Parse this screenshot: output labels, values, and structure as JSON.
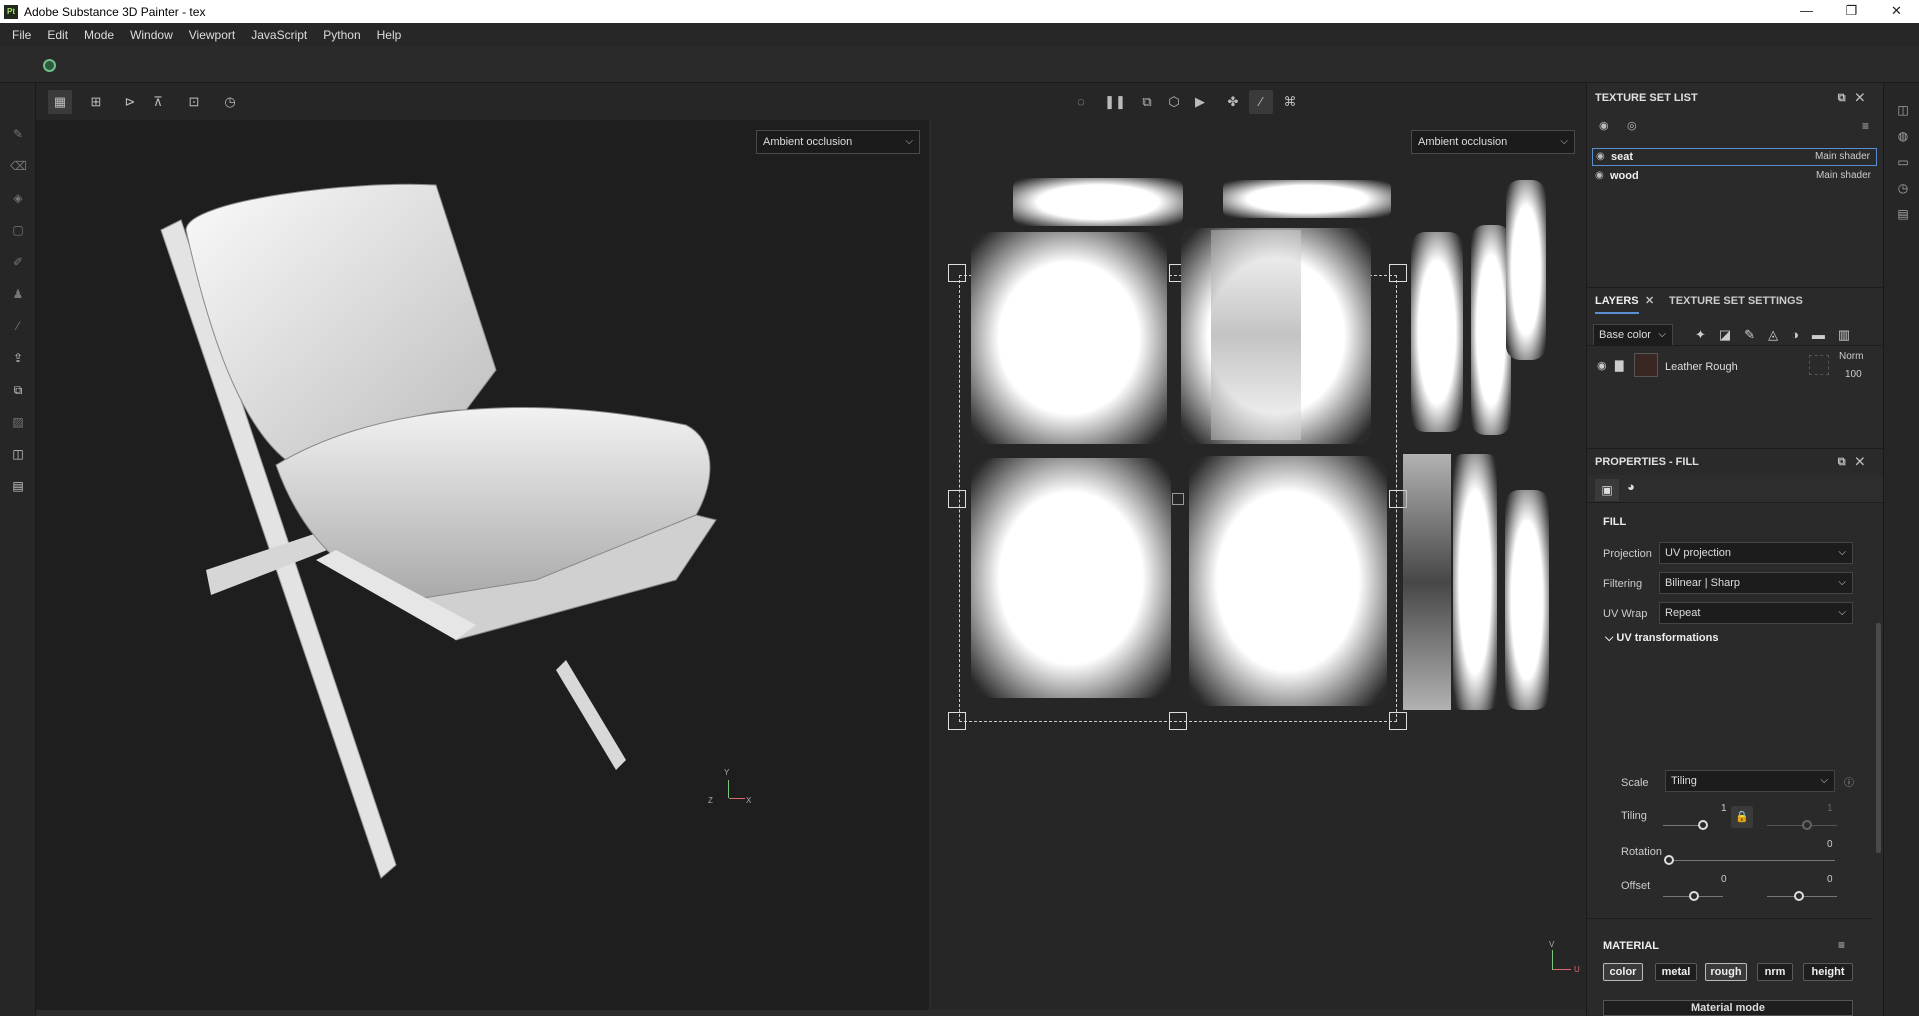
{
  "window": {
    "title": "Adobe Substance 3D Painter - tex",
    "logo": "Pt",
    "controls": [
      "—",
      "❐",
      "✕"
    ]
  },
  "menu": [
    "File",
    "Edit",
    "Mode",
    "Window",
    "Viewport",
    "JavaScript",
    "Python",
    "Help"
  ],
  "viewport": {
    "left_channel": "Ambient occlusion",
    "right_channel": "Ambient occlusion",
    "axis_3d": {
      "y": "Y",
      "x": "X",
      "z": "Z"
    },
    "axis_uv": {
      "v": "V",
      "u": "U"
    }
  },
  "texture_set_list": {
    "title": "TEXTURE SET LIST",
    "items": [
      {
        "name": "seat",
        "shader": "Main shader",
        "selected": true
      },
      {
        "name": "wood",
        "shader": "Main shader",
        "selected": false
      }
    ]
  },
  "layers": {
    "tabs": [
      "LAYERS",
      "TEXTURE SET SETTINGS"
    ],
    "channel": "Base color",
    "items": [
      {
        "name": "Leather Rough",
        "blend": "Norm",
        "opacity": "100"
      }
    ]
  },
  "properties": {
    "title": "PROPERTIES - FILL",
    "section": "FILL",
    "projection_label": "Projection",
    "projection": "UV projection",
    "filtering_label": "Filtering",
    "filtering": "Bilinear | Sharp",
    "uvwrap_label": "UV Wrap",
    "uvwrap": "Repeat",
    "uvtrans": "UV transformations",
    "scale_label": "Scale",
    "scale": "Tiling",
    "tiling_label": "Tiling",
    "tiling": "1",
    "tiling2": "1",
    "rotation_label": "Rotation",
    "rotation": "0",
    "offset_label": "Offset",
    "offset_x": "0",
    "offset_y": "0",
    "material_title": "MATERIAL",
    "material_buttons": [
      {
        "label": "color",
        "on": true
      },
      {
        "label": "metal",
        "on": false
      },
      {
        "label": "rough",
        "on": true
      },
      {
        "label": "nrm",
        "on": false
      },
      {
        "label": "height",
        "on": false
      }
    ],
    "material_mode": "Material mode"
  },
  "colors": {
    "accent": "#5b8fd1",
    "panel": "#2a2a2a",
    "viewport": "#1e1e1e"
  }
}
